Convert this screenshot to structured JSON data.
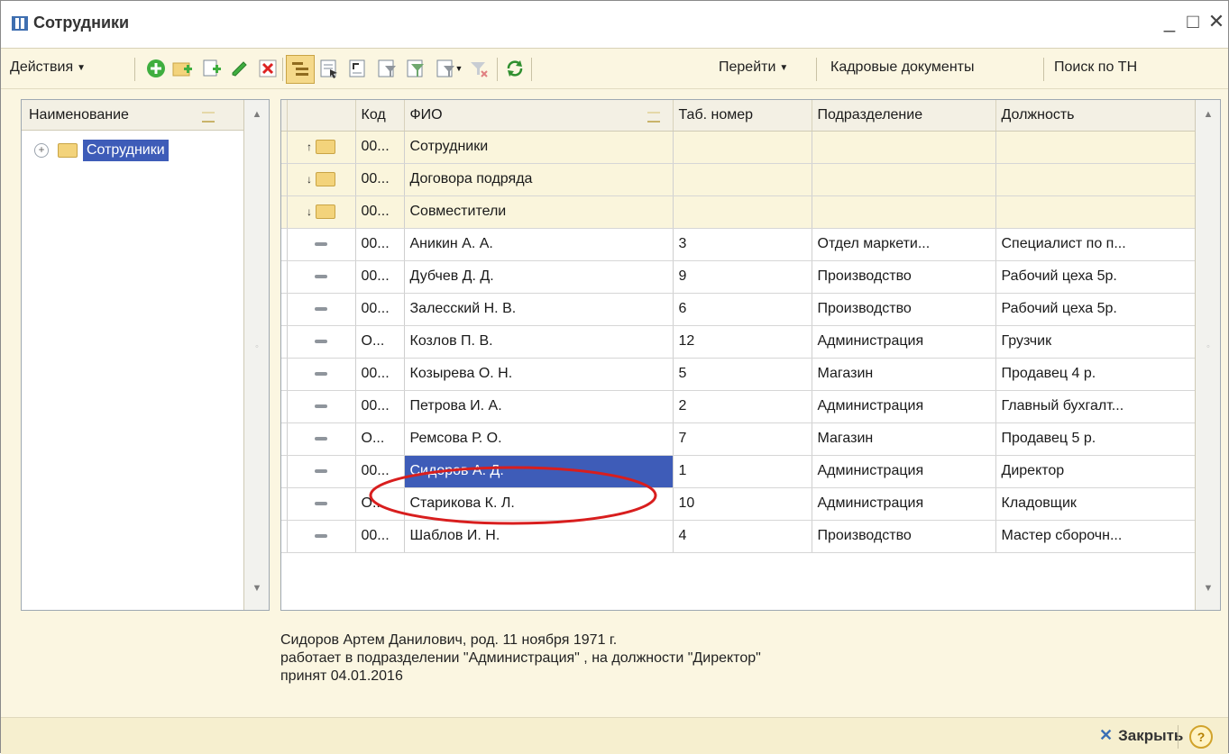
{
  "window": {
    "title": "Сотрудники"
  },
  "toolbar": {
    "actions_label": "Действия",
    "goto_label": "Перейти",
    "hr_docs_label": "Кадровые документы",
    "search_tn_label": "Поиск по ТН"
  },
  "tree": {
    "header": "Наименование",
    "root_label": "Сотрудники"
  },
  "grid": {
    "columns": [
      "Код",
      "ФИО",
      "Таб. номер",
      "Подразделение",
      "Должность"
    ],
    "rows": [
      {
        "kind": "group",
        "code": "00...",
        "name": "Сотрудники",
        "tab": "",
        "dept": "",
        "pos": ""
      },
      {
        "kind": "group",
        "code": "00...",
        "name": "Договора подряда",
        "tab": "",
        "dept": "",
        "pos": ""
      },
      {
        "kind": "group",
        "code": "00...",
        "name": "Совместители",
        "tab": "",
        "dept": "",
        "pos": ""
      },
      {
        "kind": "item",
        "code": "00...",
        "name": "Аникин А. А.",
        "tab": "3",
        "dept": "Отдел маркети...",
        "pos": "Специалист по п..."
      },
      {
        "kind": "item",
        "code": "00...",
        "name": "Дубчев Д. Д.",
        "tab": "9",
        "dept": "Производство",
        "pos": "Рабочий цеха 5р."
      },
      {
        "kind": "item",
        "code": "00...",
        "name": "Залесский Н. В.",
        "tab": "6",
        "dept": "Производство",
        "pos": "Рабочий цеха 5р."
      },
      {
        "kind": "item",
        "code": "О...",
        "name": "Козлов П. В.",
        "tab": "12",
        "dept": "Администрация",
        "pos": "Грузчик"
      },
      {
        "kind": "item",
        "code": "00...",
        "name": "Козырева О. Н.",
        "tab": "5",
        "dept": "Магазин",
        "pos": "Продавец 4 р."
      },
      {
        "kind": "item",
        "code": "00...",
        "name": "Петрова И. А.",
        "tab": "2",
        "dept": "Администрация",
        "pos": "Главный бухгалт..."
      },
      {
        "kind": "item",
        "code": "О...",
        "name": "Ремсова Р. О.",
        "tab": "7",
        "dept": "Магазин",
        "pos": "Продавец  5 р."
      },
      {
        "kind": "item",
        "code": "00...",
        "name": "Сидоров А. Д.",
        "tab": "1",
        "dept": "Администрация",
        "pos": "Директор",
        "selected": true
      },
      {
        "kind": "item",
        "code": "О...",
        "name": "Старикова К. Л.",
        "tab": "10",
        "dept": "Администрация",
        "pos": "Кладовщик"
      },
      {
        "kind": "item",
        "code": "00...",
        "name": "Шаблов И. Н.",
        "tab": "4",
        "dept": "Производство",
        "pos": "Мастер сборочн..."
      }
    ]
  },
  "info": {
    "line1": "Сидоров Артем Данилович, род. 11 ноября 1971 г.",
    "line2": "работает в подразделении \"Администрация\" , на должности \"Директор\"",
    "line3": "принят 04.01.2016"
  },
  "bottom": {
    "close_label": "Закрыть",
    "help_symbol": "?"
  },
  "colors": {
    "selection": "#3e5cb8",
    "annotation": "#d81e1e",
    "background": "#fbf6e1"
  }
}
